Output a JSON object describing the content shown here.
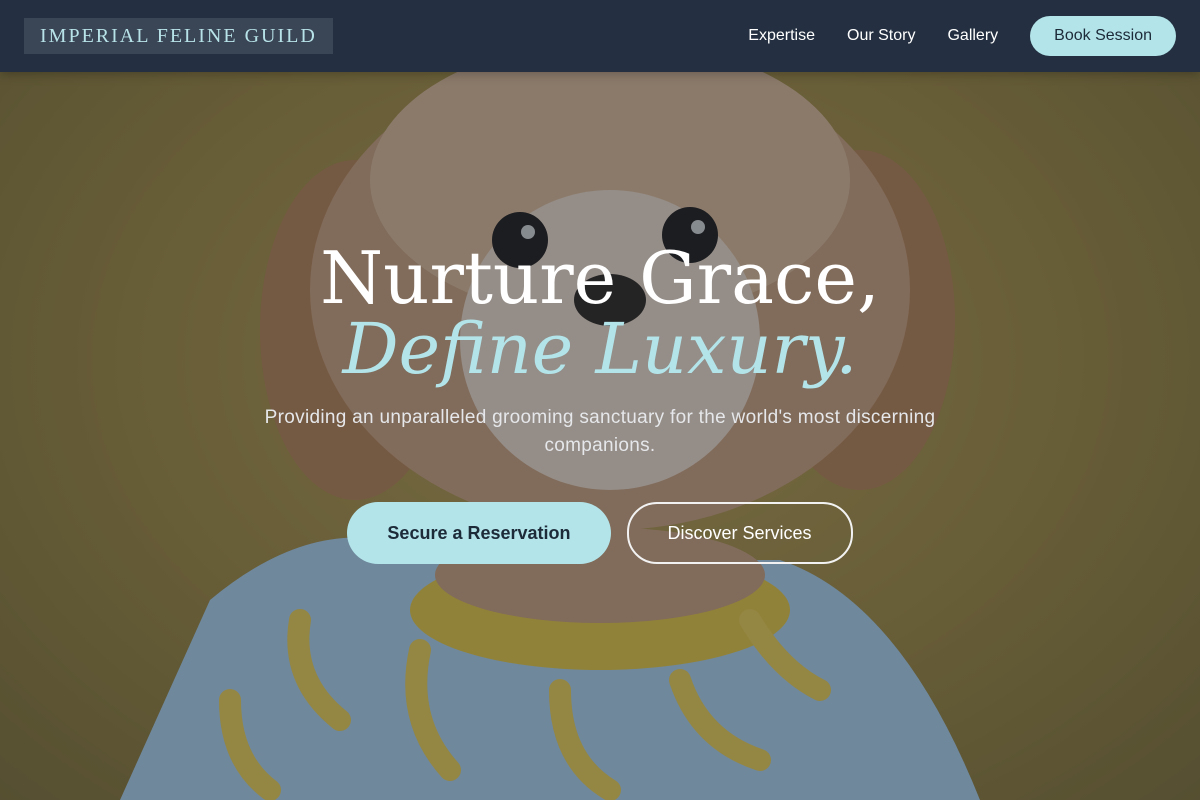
{
  "nav": {
    "logo": "IMPERIAL FELINE GUILD",
    "links": [
      "Expertise",
      "Our Story",
      "Gallery"
    ],
    "cta": "Book Session"
  },
  "hero": {
    "headline_line1": "Nurture Grace,",
    "headline_line2": "Define Luxury.",
    "subtitle": "Providing an unparalleled grooming sanctuary for the world's most discerning companions.",
    "primary_button": "Secure a Reservation",
    "secondary_button": "Discover Services"
  },
  "colors": {
    "accent": "#b2e4ea",
    "navbar": "#243041",
    "overlay": "#202a3a"
  }
}
